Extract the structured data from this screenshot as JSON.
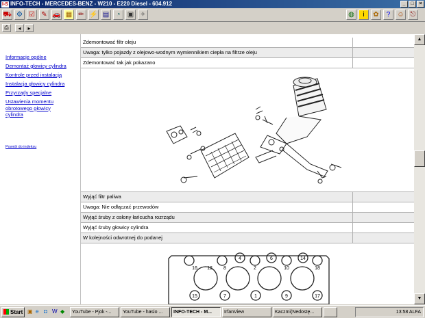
{
  "window": {
    "logo": "I-S",
    "title": "INFO-TECH - MERCEDES-BENZ - W210 - E220 Diesel - 604.912"
  },
  "sidebar": {
    "items": [
      "Informacje ogólne",
      "Demontaż głowicy cylindra",
      "Kontrole przed instalacją",
      "Instalacja głowicy cylindra",
      "Przyrządy specjalne",
      "Ustawienia momentu obrotowego głowicy cylindra"
    ],
    "back_link": "Powrót do indeksu"
  },
  "steps_top": [
    "Zdemontować filtr oleju",
    "Uwaga: tylko pojazdy z olejowo-wodnym wymiennikiem ciepła na filtrze oleju",
    "Zdemontować tak jak pokazano"
  ],
  "steps_bottom": [
    "Wyjąć filtr paliwa",
    "Uwaga: Nie odłączać przewodów",
    "Wyjąć śruby z osłony łańcucha rozrządu",
    "Wyjąć śruby głowicy cylindra",
    "W kolejności odwrotnej do podanej"
  ],
  "bolt_numbers_top": [
    "16",
    "12",
    "8",
    "4",
    "2",
    "6",
    "10",
    "14",
    "18"
  ],
  "bolt_numbers_bottom": [
    "15",
    "7",
    "1",
    "9",
    "17"
  ],
  "taskbar": {
    "start": "Start",
    "tasks": [
      "YouTube - Pjok -...",
      "YouTube - hasio ...",
      "INFO-TECH - M...",
      "IrfanView",
      "Kaczmi(Nedostę...",
      ""
    ],
    "tray_time": "13:58 ALFA"
  },
  "colors": {
    "titlebar": "#0a246a",
    "link": "#0000cc",
    "row_gray": "#ececec"
  }
}
